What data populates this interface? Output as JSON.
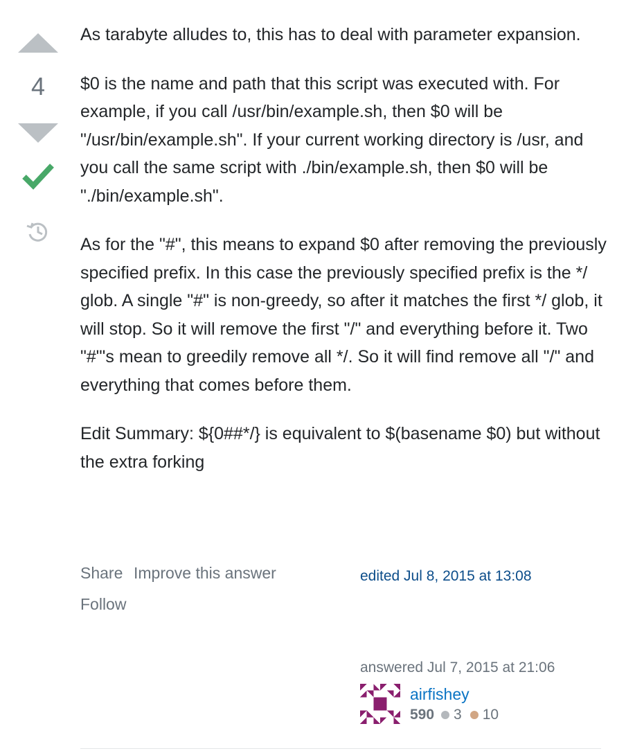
{
  "vote": {
    "count": "4"
  },
  "post": {
    "paragraphs": [
      "As tarabyte alludes to, this has to deal with parameter expansion.",
      "$0 is the name and path that this script was executed with. For example, if you call /usr/bin/example.sh, then $0 will be \"/usr/bin/example.sh\". If your current working directory is /usr, and you call the same script with ./bin/example.sh, then $0 will be \"./bin/example.sh\".",
      "As for the \"#\", this means to expand $0 after removing the previously specified prefix. In this case the previously specified prefix is the */ glob. A single \"#\" is non-greedy, so after it matches the first */ glob, it will stop. So it will remove the first \"/\" and everything before it. Two \"#\"'s mean to greedily remove all */. So it will find remove all \"/\" and everything that comes before them.",
      "Edit Summary: ${0##*/} is equivalent to $(basename $0) but without the extra forking"
    ]
  },
  "menu": {
    "share": "Share",
    "improve": "Improve this answer",
    "follow": "Follow"
  },
  "edited": "edited Jul 8, 2015 at 13:08",
  "answer": {
    "answered": "answered Jul 7, 2015 at 21:06",
    "user": "airfishey",
    "reputation": "590",
    "silver_badges": "3",
    "bronze_badges": "10"
  },
  "colors": {
    "accepted": "#48a868",
    "link": "#0a74c4",
    "muted": "#6a737c",
    "avatar": "#8a1f6e"
  },
  "icons": [
    "vote-up-icon",
    "vote-down-icon",
    "accepted-check-icon",
    "history-icon",
    "avatar-identicon",
    "silver-badge-icon",
    "bronze-badge-icon"
  ]
}
